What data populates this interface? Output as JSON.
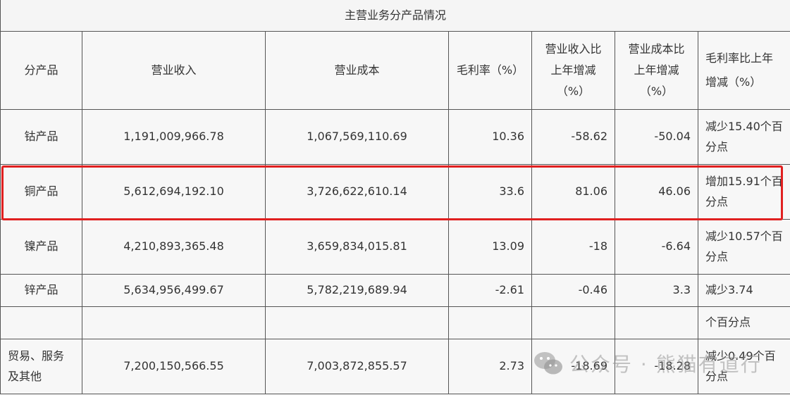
{
  "table": {
    "caption": "主营业务分产品情况",
    "headers": {
      "product": "分产品",
      "revenue": "营业收入",
      "cost": "营业成本",
      "margin": "毛利率（%）",
      "rev_change_1": "营业收入比",
      "rev_change_2": "上年增减",
      "rev_change_3": "（%）",
      "cost_change_1": "营业成本比",
      "cost_change_2": "上年增减",
      "cost_change_3": "（%）",
      "margin_change_1": "毛利率比上年",
      "margin_change_2": "增减（%）"
    },
    "rows": [
      {
        "product": "钴产品",
        "revenue": "1,191,009,966.78",
        "cost": "1,067,569,110.69",
        "margin": "10.36",
        "rev_change": "-58.62",
        "cost_change": "-50.04",
        "margin_change_1": "减少15.40个百",
        "margin_change_2": "分点"
      },
      {
        "product": "铜产品",
        "revenue": "5,612,694,192.10",
        "cost": "3,726,622,610.14",
        "margin": "33.6",
        "rev_change": "81.06",
        "cost_change": "46.06",
        "margin_change_1": "增加15.91个百",
        "margin_change_2": "分点"
      },
      {
        "product": "镍产品",
        "revenue": "4,210,893,365.48",
        "cost": "3,659,834,015.81",
        "margin": "13.09",
        "rev_change": "-18",
        "cost_change": "-6.64",
        "margin_change_1": "减少10.57个百",
        "margin_change_2": "分点"
      },
      {
        "product": "锌产品",
        "revenue": "5,634,956,499.67",
        "cost": "5,782,219,689.94",
        "margin": "-2.61",
        "rev_change": "-0.46",
        "cost_change": "3.3",
        "margin_change_1": "减少3.74"
      },
      {
        "margin_change_1": "个百分点"
      },
      {
        "product_1": "贸易、服务",
        "product_2": "及其他",
        "revenue": "7,200,150,566.55",
        "cost": "7,003,872,855.57",
        "margin": "2.73",
        "rev_change": "-18.69",
        "cost_change": "-18.28",
        "margin_change_1": "减少0.49个百",
        "margin_change_2": "分点"
      }
    ]
  },
  "watermark": {
    "text": "公众号 · 熊猫有道行",
    "icon": "wechat-icon"
  }
}
